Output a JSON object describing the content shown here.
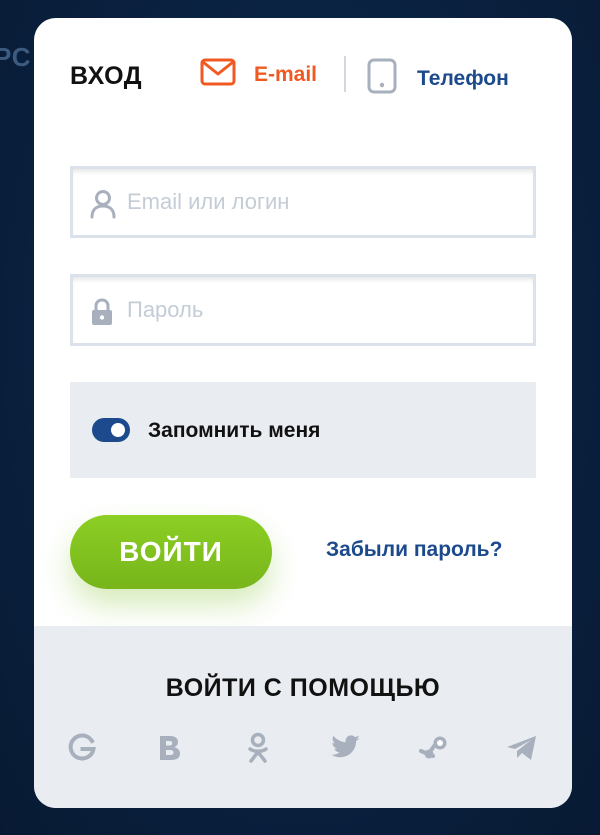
{
  "background": {
    "partial_text": "РС"
  },
  "header": {
    "title": "ВХОД",
    "tabs": [
      {
        "label": "E-mail",
        "icon": "envelope-icon",
        "color": "#f05a22",
        "active": true
      },
      {
        "label": "Телефон",
        "icon": "phone-icon",
        "color": "#1c4a8c",
        "active": false
      }
    ]
  },
  "form": {
    "login": {
      "placeholder": "Email или логин",
      "value": "",
      "icon": "user-icon"
    },
    "password": {
      "placeholder": "Пароль",
      "value": "",
      "icon": "lock-icon"
    },
    "remember": {
      "label": "Запомнить меня",
      "checked": true
    },
    "submit_label": "ВОЙТИ",
    "forgot_label": "Забыли пароль?"
  },
  "social": {
    "title": "ВОЙТИ С ПОМОЩЬЮ",
    "providers": [
      "google-icon",
      "vk-icon",
      "odnoklassniki-icon",
      "twitter-icon",
      "steam-icon",
      "telegram-icon"
    ]
  },
  "colors": {
    "accent_orange": "#f05a22",
    "brand_blue": "#1c4a8c",
    "button_green": "#82c221",
    "panel_gray": "#e9ecf1",
    "icon_gray": "#a7b0bc"
  }
}
